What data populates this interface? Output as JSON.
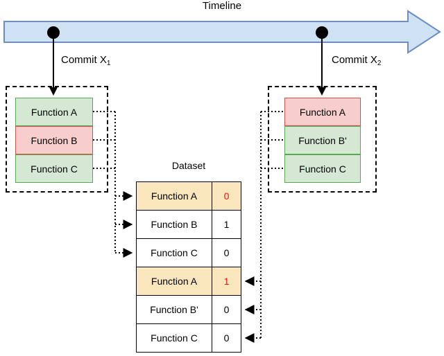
{
  "diagram": {
    "timeline": {
      "label": "Timeline",
      "arrow_fill": "#cfe2f3",
      "arrow_stroke": "#6c8ebf"
    },
    "commits": [
      {
        "id": "x1",
        "label_prefix": "Commit X",
        "label_sub": "1",
        "functions": [
          {
            "label": "Function A",
            "state": "unchanged",
            "color": "#d5e8d4"
          },
          {
            "label": "Function B",
            "state": "changed",
            "color": "#f8cecc"
          },
          {
            "label": "Function C",
            "state": "unchanged",
            "color": "#d5e8d4"
          }
        ]
      },
      {
        "id": "x2",
        "label_prefix": "Commit X",
        "label_sub": "2",
        "functions": [
          {
            "label": "Function A",
            "state": "changed",
            "color": "#f8cecc"
          },
          {
            "label": "Function B'",
            "state": "unchanged",
            "color": "#d5e8d4"
          },
          {
            "label": "Function C",
            "state": "unchanged",
            "color": "#d5e8d4"
          }
        ]
      }
    ],
    "dataset": {
      "title": "Dataset",
      "rows": [
        {
          "name": "Function A",
          "value": "0",
          "highlight": true,
          "value_red": true
        },
        {
          "name": "Function B",
          "value": "1",
          "highlight": false,
          "value_red": false
        },
        {
          "name": "Function C",
          "value": "0",
          "highlight": false,
          "value_red": false
        },
        {
          "name": "Function A",
          "value": "1",
          "highlight": true,
          "value_red": true
        },
        {
          "name": "Function B'",
          "value": "0",
          "highlight": false,
          "value_red": false
        },
        {
          "name": "Function C",
          "value": "0",
          "highlight": false,
          "value_red": false
        }
      ]
    },
    "colors": {
      "highlight_row": "#fae6bc",
      "red_value": "#ee1111",
      "green_fill": "#d5e8d4",
      "green_stroke": "#5aa756",
      "red_fill": "#f8cecc",
      "red_stroke": "#d6504a",
      "connector": "#000000"
    }
  }
}
